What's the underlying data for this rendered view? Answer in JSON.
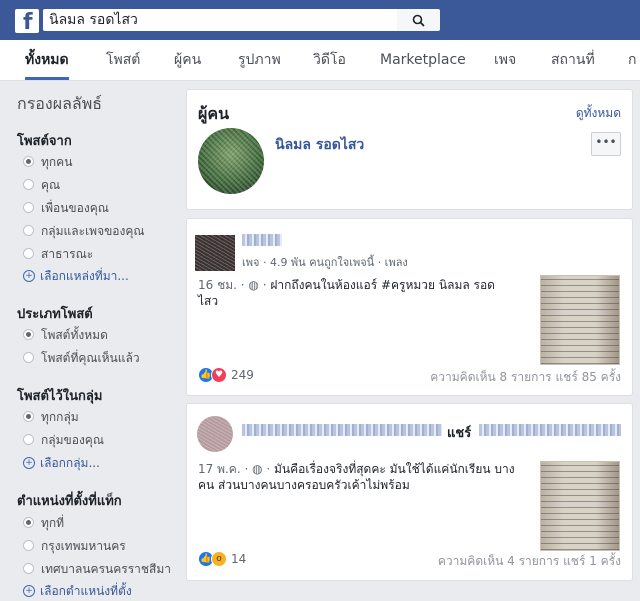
{
  "header": {
    "search_value": "นิลมล รอดไสว",
    "logo_letter": "f"
  },
  "tabs": [
    {
      "label": "ทั้งหมด"
    },
    {
      "label": "โพสต์"
    },
    {
      "label": "ผู้คน"
    },
    {
      "label": "รูปภาพ"
    },
    {
      "label": "วิดีโอ"
    },
    {
      "label": "Marketplace"
    },
    {
      "label": "เพจ"
    },
    {
      "label": "สถานที่"
    },
    {
      "label": "ก"
    }
  ],
  "sidebar": {
    "title": "กรองผลลัพธ์",
    "groups": [
      {
        "heading": "โพสต์จาก",
        "options": [
          "ทุกคน",
          "คุณ",
          "เพื่อนของคุณ",
          "กลุ่มและเพจของคุณ",
          "สาธารณะ"
        ],
        "selected": "ทุกคน",
        "link": "เลือกแหล่งที่มา..."
      },
      {
        "heading": "ประเภทโพสต์",
        "options": [
          "โพสต์ทั้งหมด",
          "โพสต์ที่คุณเห็นแล้ว"
        ],
        "selected": "โพสต์ทั้งหมด"
      },
      {
        "heading": "โพสต์ไว้ในกลุ่ม",
        "options": [
          "ทุกกลุ่ม",
          "กลุ่มของคุณ"
        ],
        "selected": "ทุกกลุ่ม",
        "link": "เลือกกลุ่ม..."
      },
      {
        "heading": "ตำแหน่งที่ตั้งที่แท็ก",
        "options": [
          "ทุกที่",
          "กรุงเทพมหานคร",
          "เทศบาลนครนครราชสีมา"
        ],
        "selected": "ทุกที่",
        "link": "เลือกตำแหน่งที่ตั้ง"
      }
    ]
  },
  "people_card": {
    "title": "ผู้คน",
    "see_all": "ดูทั้งหมด",
    "person_name": "นิลมล รอดไสว",
    "more_label": "•••"
  },
  "post1": {
    "page_meta": "เพจ · 4.9 พัน คนถูกใจเพจนี้ · เพลง",
    "time": "16 ชม. · ",
    "text": "ฝากถึงคนในห้องแอร์ #ครูหมวย นิลมล รอด ไสว",
    "reaction_count": "249",
    "stats": "ความคิดเห็น 8 รายการ  แชร์ 85 ครั้ง"
  },
  "post2": {
    "shared_label": "แชร์",
    "time": "17 พ.ค. · ",
    "text": "มันคือเรื่องจริงที่สุดคะ มันใช้ได้แค่นักเรียน บางคน ส่วนบางคนบางครอบครัวเค้าไม่พร้อม",
    "reaction_count": "14",
    "stats": "ความคิดเห็น 4 รายการ  แชร์ 1 ครั้ง"
  },
  "colors": {
    "brand": "#3b5998",
    "link": "#365899",
    "like": "#1877f2",
    "love": "#f33e58",
    "wow": "#f7b125"
  }
}
